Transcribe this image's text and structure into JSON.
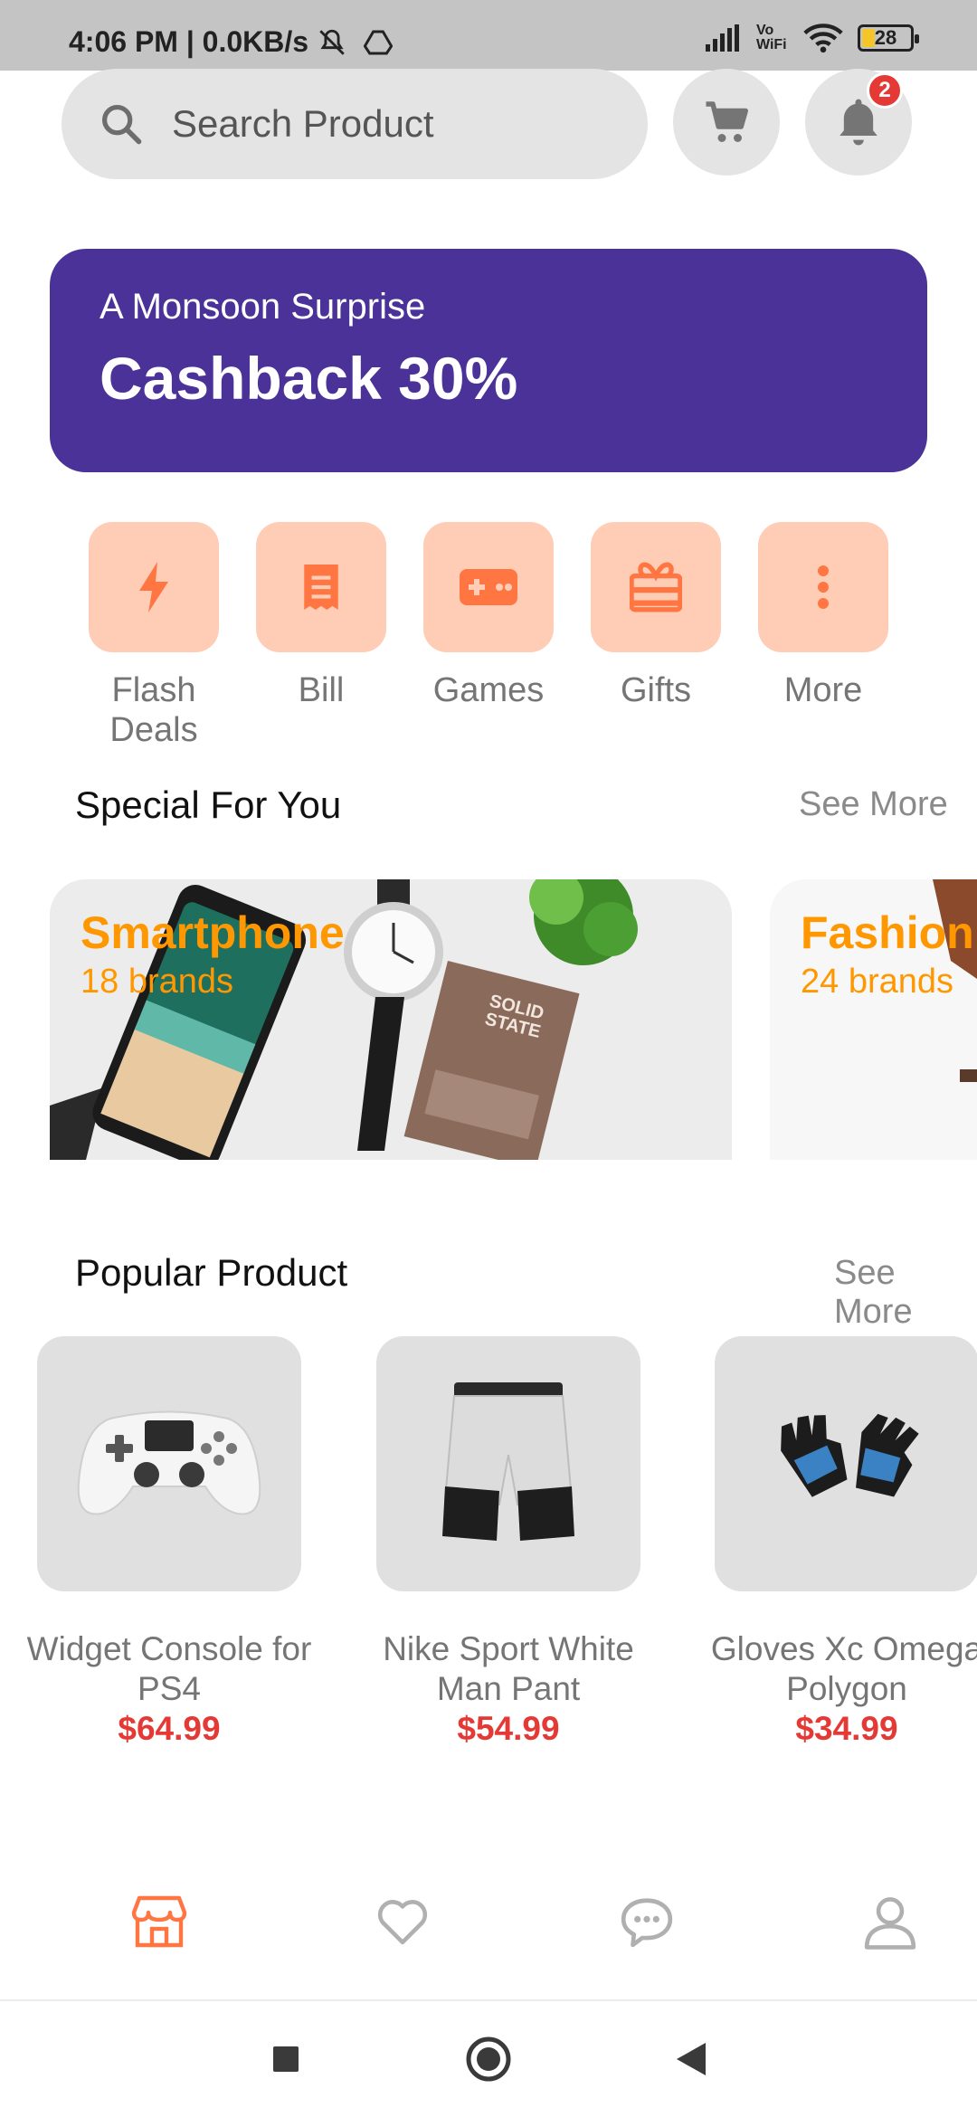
{
  "status_bar": {
    "time": "4:06 PM | 0.0KB/s",
    "battery": "28",
    "network": "Vo WiFi"
  },
  "search": {
    "placeholder": "Search Product"
  },
  "notifications": {
    "badge": "2"
  },
  "banner": {
    "subtitle": "A Monsoon Surprise",
    "title": "Cashback 30%",
    "color": "#4a3298"
  },
  "categories": [
    {
      "label": "Flash\nDeals",
      "icon": "flash-icon"
    },
    {
      "label": "Bill",
      "icon": "bill-icon"
    },
    {
      "label": "Games",
      "icon": "gamepad-icon"
    },
    {
      "label": "Gifts",
      "icon": "gift-icon"
    },
    {
      "label": "More",
      "icon": "more-vertical-icon"
    }
  ],
  "special": {
    "title": "Special For You",
    "see_more": "See More",
    "cards": [
      {
        "title": "Smartphone",
        "subtitle": "18 brands"
      },
      {
        "title": "Fashion",
        "subtitle": "24 brands"
      }
    ]
  },
  "popular": {
    "title": "Popular Product",
    "see_more": "See More",
    "products": [
      {
        "name": "Widget Console for PS4",
        "price": "$64.99"
      },
      {
        "name": "Nike Sport White Man Pant",
        "price": "$54.99"
      },
      {
        "name": "Gloves Xc Omega Polygon",
        "price": "$34.99"
      }
    ]
  },
  "bottom_nav": [
    {
      "icon": "shop-icon",
      "active": true
    },
    {
      "icon": "heart-icon",
      "active": false
    },
    {
      "icon": "chat-icon",
      "active": false
    },
    {
      "icon": "user-icon",
      "active": false
    }
  ],
  "colors": {
    "accent": "#ff7643",
    "category_bg": "#ffcdb6",
    "price": "#e53935",
    "highlight": "#ff9800"
  }
}
